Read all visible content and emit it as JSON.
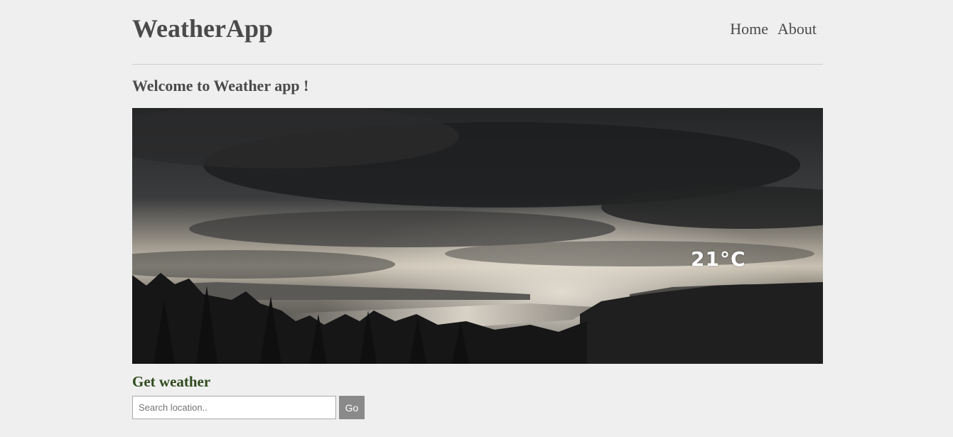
{
  "header": {
    "brand": "WeatherApp",
    "nav": [
      {
        "label": "Home"
      },
      {
        "label": "About"
      }
    ]
  },
  "main": {
    "welcome": "Welcome to Weather app !",
    "hero": {
      "temperature": "21°C",
      "image": "stormy-landscape-photo"
    },
    "search": {
      "heading": "Get weather",
      "placeholder": "Search location..",
      "value": "",
      "button_label": "Go"
    }
  },
  "colors": {
    "background": "#efefef",
    "text": "#4a4a4a",
    "heading_green": "#2f4a1e",
    "button_gray": "#8a8a8a"
  }
}
